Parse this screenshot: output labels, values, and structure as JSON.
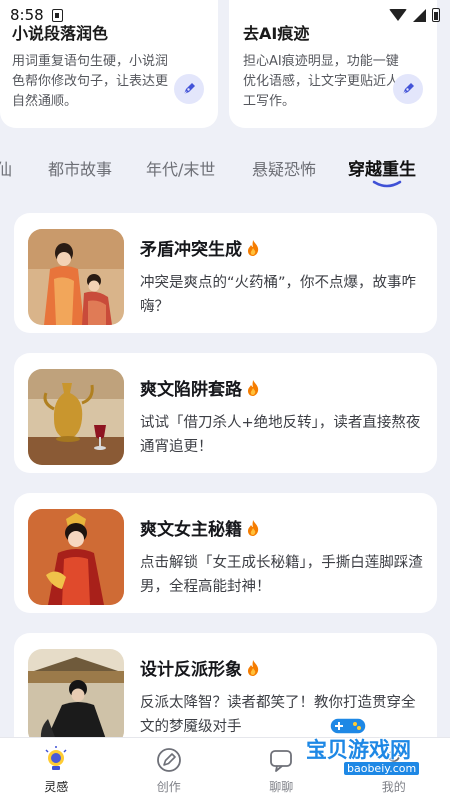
{
  "status_bar": {
    "time": "8:58"
  },
  "feature_cards": [
    {
      "title": "小说段落润色",
      "desc": "用词重复语句生硬，小说润色帮你修改句子，让表达更自然通顺。"
    },
    {
      "title": "去AI痕迹",
      "desc": "担心AI痕迹明显，功能一键优化语感，让文字更贴近人工写作。"
    }
  ],
  "tabs": [
    {
      "label": "仙"
    },
    {
      "label": "都市故事"
    },
    {
      "label": "年代/末世"
    },
    {
      "label": "悬疑恐怖"
    },
    {
      "label": "穿越重生"
    }
  ],
  "active_tab": "穿越重生",
  "cards": [
    {
      "title": "矛盾冲突生成",
      "desc": "冲突是爽点的“火药桶”，你不点爆，故事咋嗨？"
    },
    {
      "title": "爽文陷阱套路",
      "desc": "试试「借刀杀人+绝地反转」，读者直接熬夜通宵追更！"
    },
    {
      "title": "爽文女主秘籍",
      "desc": "点击解锁「女王成长秘籍」，手撕白莲脚踩渣男，全程高能封神！"
    },
    {
      "title": "设计反派形象",
      "desc": "反派太降智？读者都笑了！教你打造贯穿全文的梦魇级对手"
    }
  ],
  "bottom_nav": [
    {
      "label": "灵感",
      "icon": "lightbulb-icon"
    },
    {
      "label": "创作",
      "icon": "edit-icon"
    },
    {
      "label": "聊聊",
      "icon": "chat-icon"
    },
    {
      "label": "我的",
      "icon": "profile-icon"
    }
  ],
  "watermark": {
    "text": "宝贝游戏网",
    "url": "baobeiy.com"
  },
  "colors": {
    "accent": "#3f51d6",
    "background": "#eef0f7",
    "fire": "#f57c00"
  }
}
